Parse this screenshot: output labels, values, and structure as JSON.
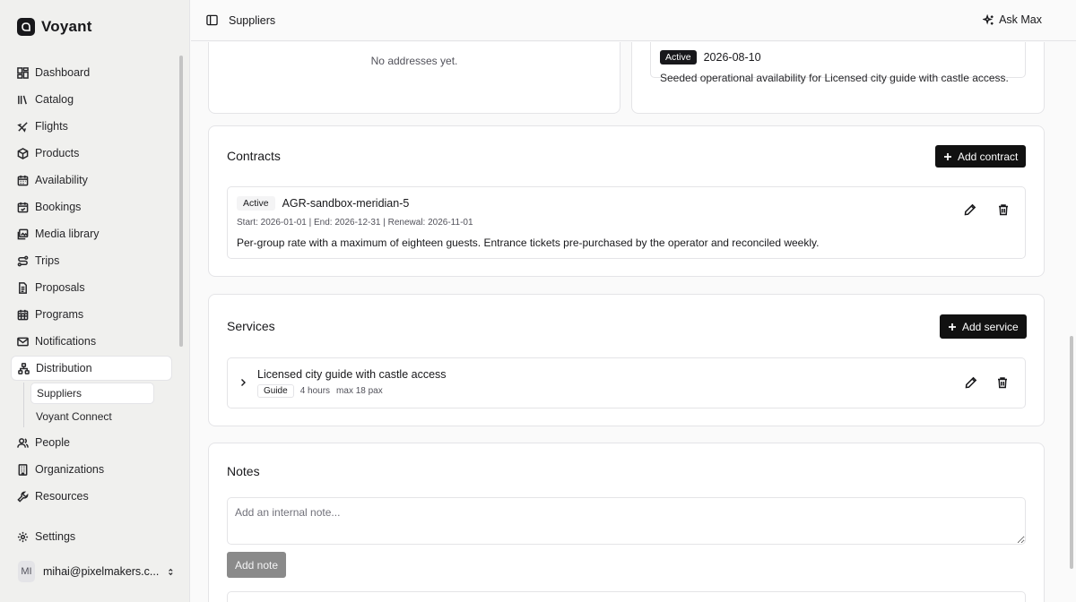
{
  "brand": {
    "name": "Voyant"
  },
  "sidebar": {
    "items": [
      {
        "label": "Dashboard",
        "icon": "dashboard-icon"
      },
      {
        "label": "Catalog",
        "icon": "catalog-icon"
      },
      {
        "label": "Flights",
        "icon": "plane-icon"
      },
      {
        "label": "Products",
        "icon": "package-icon"
      },
      {
        "label": "Availability",
        "icon": "calendar-icon"
      },
      {
        "label": "Bookings",
        "icon": "calendar-check-icon"
      },
      {
        "label": "Media library",
        "icon": "images-icon"
      },
      {
        "label": "Trips",
        "icon": "route-icon"
      },
      {
        "label": "Proposals",
        "icon": "document-icon"
      },
      {
        "label": "Programs",
        "icon": "calendar-grid-icon"
      },
      {
        "label": "Notifications",
        "icon": "mail-icon"
      },
      {
        "label": "Distribution",
        "icon": "network-icon"
      }
    ],
    "sub_items": [
      {
        "label": "Suppliers"
      },
      {
        "label": "Voyant Connect"
      }
    ],
    "items_after": [
      {
        "label": "People",
        "icon": "users-icon"
      },
      {
        "label": "Organizations",
        "icon": "building-icon"
      },
      {
        "label": "Resources",
        "icon": "wrench-icon"
      }
    ],
    "settings": {
      "label": "Settings",
      "icon": "gear-icon"
    },
    "user": {
      "initials": "MI",
      "email": "mihai@pixelmakers.c..."
    }
  },
  "topbar": {
    "title": "Suppliers",
    "ask_label": "Ask Max"
  },
  "addresses": {
    "empty_text": "No addresses yet."
  },
  "availability": {
    "status": "Active",
    "date": "2026-08-10",
    "description": "Seeded operational availability for Licensed city guide with castle access."
  },
  "contracts": {
    "title": "Contracts",
    "add_label": "Add contract",
    "item": {
      "status": "Active",
      "name": "AGR-sandbox-meridian-5",
      "dates": "Start: 2026-01-01 | End: 2026-12-31 | Renewal: 2026-11-01",
      "description": "Per-group rate with a maximum of eighteen guests. Entrance tickets pre-purchased by the operator and reconciled weekly."
    }
  },
  "services": {
    "title": "Services",
    "add_label": "Add service",
    "item": {
      "name": "Licensed city guide with castle access",
      "type": "Guide",
      "duration": "4 hours",
      "capacity": "max 18 pax"
    }
  },
  "notes": {
    "title": "Notes",
    "placeholder": "Add an internal note...",
    "add_label": "Add note"
  }
}
